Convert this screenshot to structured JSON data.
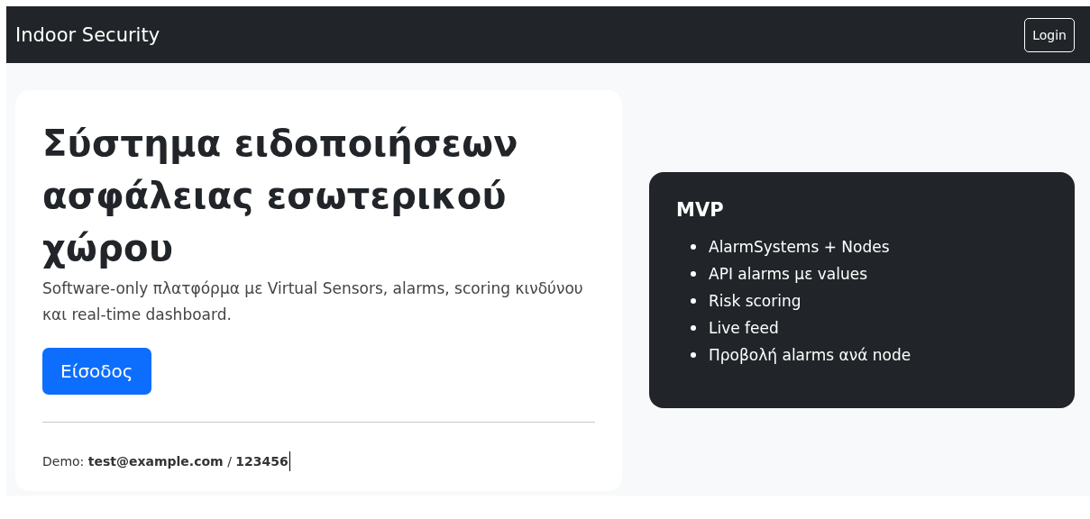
{
  "navbar": {
    "brand": "Indoor Security",
    "login_button": "Login"
  },
  "hero": {
    "title": "Σύστημα ειδοποιήσεων ασφάλειας εσωτερικού χώρου",
    "lead": "Software-only πλατφόρμα με Virtual Sensors, alarms, scoring κινδύνου και real-time dashboard.",
    "button": "Είσοδος",
    "demo": "Demo: **test@example.com** / **123456**"
  },
  "mvp_card": {
    "title": "MVP",
    "items": [
      "AlarmSystems + Nodes",
      "API alarms με values",
      "Risk scoring",
      "Live feed",
      "Προβολή alarms ανά node"
    ]
  }
}
